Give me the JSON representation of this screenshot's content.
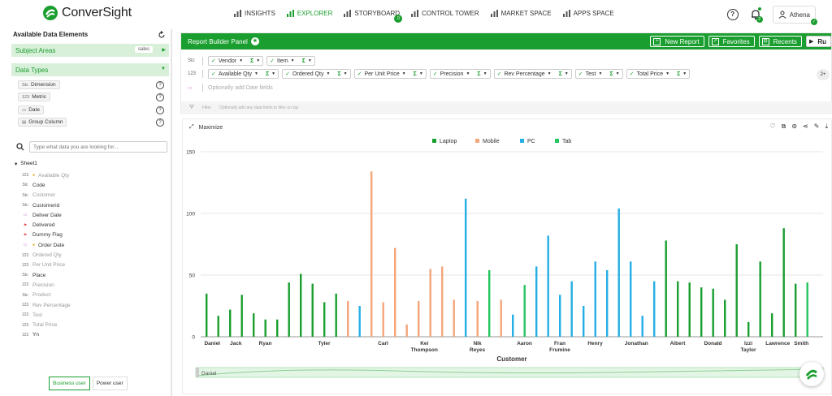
{
  "app": {
    "logo_text": "ConverSight"
  },
  "nav": {
    "items": [
      {
        "label": "INSIGHTS",
        "active": false,
        "icon": "bar-chart-icon"
      },
      {
        "label": "EXPLORER",
        "active": true,
        "icon": "bar-chart-icon"
      },
      {
        "label": "STORYBOARD",
        "active": false,
        "icon": "storyboard-icon"
      },
      {
        "label": "CONTROL TOWER",
        "active": false,
        "icon": "tower-icon"
      },
      {
        "label": "MARKET SPACE",
        "active": false,
        "icon": "store-icon"
      },
      {
        "label": "APPS SPACE",
        "active": false,
        "icon": "apps-grid-icon"
      }
    ],
    "storyboard_badge": "0",
    "help_label": "?",
    "notification_count": "2",
    "user_name": "Athena"
  },
  "sidebar": {
    "title": "Available Data Elements",
    "subject_areas_label": "Subject Areas",
    "subject_area_value": "sales",
    "data_types_label": "Data Types",
    "data_types": [
      {
        "icon": "Stc",
        "label": "Dimension"
      },
      {
        "icon": "123",
        "label": "Metric"
      },
      {
        "icon": "▭",
        "label": "Date"
      },
      {
        "icon": "▤",
        "label": "Group Column"
      }
    ],
    "search_placeholder": "Type what data you are looking for...",
    "tree_root": "Sheet1",
    "fields": [
      {
        "type": "123",
        "label": "Available Qty",
        "muted": true,
        "dot": true
      },
      {
        "type": "Stc",
        "label": "Code",
        "muted": false
      },
      {
        "type": "Stc",
        "label": "Customer",
        "muted": true
      },
      {
        "type": "Stc",
        "label": "Customerid",
        "muted": false
      },
      {
        "type": "date",
        "label": "Deliver Date",
        "muted": false
      },
      {
        "type": "flag",
        "label": "Delivered",
        "muted": false
      },
      {
        "type": "flag",
        "label": "Dummy Flag",
        "muted": false
      },
      {
        "type": "date",
        "label": "Order Date",
        "muted": false,
        "dot": true
      },
      {
        "type": "123",
        "label": "Ordered Qty",
        "muted": true
      },
      {
        "type": "123",
        "label": "Per Unit Price",
        "muted": true
      },
      {
        "type": "Stc",
        "label": "Place",
        "muted": false
      },
      {
        "type": "123",
        "label": "Precision",
        "muted": true
      },
      {
        "type": "Stc",
        "label": "Product",
        "muted": true
      },
      {
        "type": "123",
        "label": "Rev Percentage",
        "muted": true
      },
      {
        "type": "123",
        "label": "Test",
        "muted": true
      },
      {
        "type": "123",
        "label": "Total Price",
        "muted": true
      },
      {
        "type": "123",
        "label": "Yn",
        "muted": false
      }
    ],
    "role_business": "Business user",
    "role_power": "Power user"
  },
  "builder": {
    "title": "Report Builder Panel",
    "buttons": {
      "new_report": "New Report",
      "favorites": "Favorites",
      "recents": "Recents",
      "run": "Ru"
    },
    "dim_icon": "Stc",
    "dimension_fields": [
      "Vendor",
      "Item"
    ],
    "metric_icon": "123",
    "metric_fields": [
      "Available Qty",
      "Ordered Qty",
      "Per Unit Price",
      "Precision",
      "Rev Percentage",
      "Test",
      "Total Price"
    ],
    "date_placeholder": "Optionally add Date fields",
    "overflow": "2+",
    "filter_label": "Filter",
    "filter_placeholder": "Optionally add any data fields to filter on top"
  },
  "chart_card": {
    "maximize_label": "Maximize"
  },
  "chart_data": {
    "type": "bar",
    "xlabel": "Customer",
    "ylabel": "",
    "ylim": [
      0,
      150
    ],
    "yticks": [
      0,
      50,
      100,
      150
    ],
    "legend_position": "top-center",
    "grid": "y",
    "legend": [
      {
        "name": "Laptop",
        "color": "#1a9e2f"
      },
      {
        "name": "Mobile",
        "color": "#f4a57a"
      },
      {
        "name": "PC",
        "color": "#25aee6"
      },
      {
        "name": "Tab",
        "color": "#22c55e"
      }
    ],
    "categories": [
      "Daniel",
      "Jack",
      "Ryan",
      "Tyler",
      "Carl",
      "Kei Thompson",
      "Nik Reyes",
      "Aaron",
      "Fran Frumine",
      "Henry",
      "Jonathan",
      "Albert",
      "Donald",
      "Izzi Taylor",
      "Lawrence",
      "Smith"
    ],
    "bars": [
      {
        "c": 0,
        "s": "Laptop",
        "v": 35
      },
      {
        "c": 0,
        "s": "Laptop",
        "v": 17
      },
      {
        "c": 1,
        "s": "Laptop",
        "v": 22
      },
      {
        "c": 1,
        "s": "Laptop",
        "v": 34
      },
      {
        "c": 2,
        "s": "Laptop",
        "v": 19
      },
      {
        "c": 2,
        "s": "Laptop",
        "v": 14
      },
      {
        "c": 2,
        "s": "Laptop",
        "v": 14
      },
      {
        "c": 3,
        "s": "Laptop",
        "v": 44
      },
      {
        "c": 3,
        "s": "Laptop",
        "v": 51
      },
      {
        "c": 3,
        "s": "Laptop",
        "v": 43
      },
      {
        "c": 3,
        "s": "Laptop",
        "v": 28
      },
      {
        "c": 3,
        "s": "Laptop",
        "v": 35
      },
      {
        "c": 3,
        "s": "Mobile",
        "v": 29
      },
      {
        "c": 3,
        "s": "PC",
        "v": 25
      },
      {
        "c": 4,
        "s": "Mobile",
        "v": 134
      },
      {
        "c": 4,
        "s": "Mobile",
        "v": 28
      },
      {
        "c": 4,
        "s": "Mobile",
        "v": 72
      },
      {
        "c": 5,
        "s": "Mobile",
        "v": 10
      },
      {
        "c": 5,
        "s": "Mobile",
        "v": 29
      },
      {
        "c": 5,
        "s": "Mobile",
        "v": 55
      },
      {
        "c": 5,
        "s": "Mobile",
        "v": 57
      },
      {
        "c": 6,
        "s": "Mobile",
        "v": 30
      },
      {
        "c": 6,
        "s": "PC",
        "v": 112
      },
      {
        "c": 6,
        "s": "Mobile",
        "v": 29
      },
      {
        "c": 6,
        "s": "Tab",
        "v": 54
      },
      {
        "c": 6,
        "s": "Mobile",
        "v": 30
      },
      {
        "c": 7,
        "s": "PC",
        "v": 18
      },
      {
        "c": 7,
        "s": "Tab",
        "v": 42
      },
      {
        "c": 7,
        "s": "PC",
        "v": 57
      },
      {
        "c": 8,
        "s": "PC",
        "v": 82
      },
      {
        "c": 8,
        "s": "PC",
        "v": 34
      },
      {
        "c": 8,
        "s": "PC",
        "v": 45
      },
      {
        "c": 9,
        "s": "PC",
        "v": 25
      },
      {
        "c": 9,
        "s": "PC",
        "v": 61
      },
      {
        "c": 9,
        "s": "PC",
        "v": 54
      },
      {
        "c": 10,
        "s": "PC",
        "v": 104
      },
      {
        "c": 10,
        "s": "PC",
        "v": 61
      },
      {
        "c": 10,
        "s": "PC",
        "v": 17
      },
      {
        "c": 10,
        "s": "PC",
        "v": 45
      },
      {
        "c": 11,
        "s": "Laptop",
        "v": 78
      },
      {
        "c": 11,
        "s": "Laptop",
        "v": 45
      },
      {
        "c": 11,
        "s": "Laptop",
        "v": 44
      },
      {
        "c": 12,
        "s": "Laptop",
        "v": 40
      },
      {
        "c": 12,
        "s": "Laptop",
        "v": 39
      },
      {
        "c": 12,
        "s": "Laptop",
        "v": 30
      },
      {
        "c": 13,
        "s": "Laptop",
        "v": 75
      },
      {
        "c": 13,
        "s": "Laptop",
        "v": 12
      },
      {
        "c": 13,
        "s": "Laptop",
        "v": 61
      },
      {
        "c": 14,
        "s": "Laptop",
        "v": 19
      },
      {
        "c": 14,
        "s": "Laptop",
        "v": 88
      },
      {
        "c": 15,
        "s": "Laptop",
        "v": 43
      },
      {
        "c": 15,
        "s": "Tab",
        "v": 44
      }
    ],
    "scrollbar_label": "Daniel"
  }
}
